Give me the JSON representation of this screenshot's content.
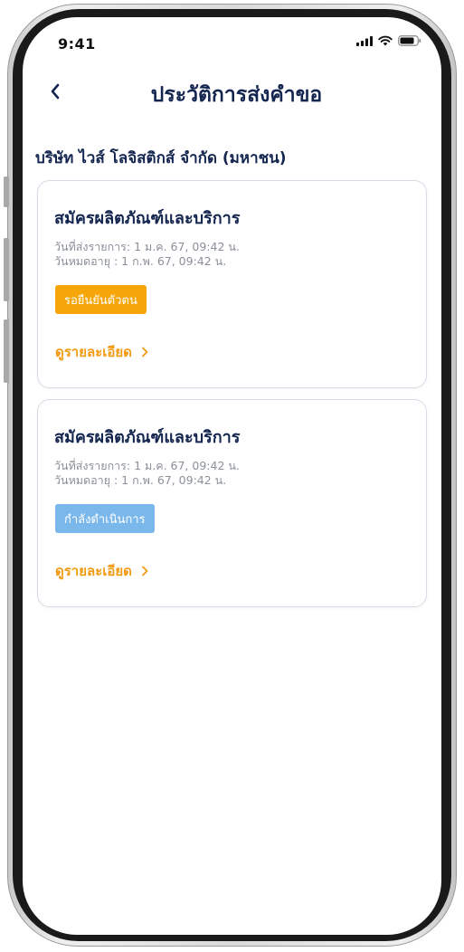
{
  "status_bar": {
    "time": "9:41",
    "icons": [
      "signal-icon",
      "wifi-icon",
      "battery-icon"
    ]
  },
  "nav": {
    "back_icon": "chevron-left-icon",
    "title": "ประวัติการส่งคำขอ"
  },
  "company": {
    "name": "บริษัท ไวส์ โลจิสติกส์ จำกัด (มหาชน)"
  },
  "requests": [
    {
      "title": "สมัครผลิตภัณฑ์และบริการ",
      "submitted": "วันที่ส่งรายการ: 1 ม.ค. 67, 09:42 น.",
      "expires": "วันหมดอายุ : 1 ก.พ. 67, 09:42 น.",
      "status": "รอยืนยันตัวตน",
      "status_color": "#f6a609",
      "link": "ดูรายละเอียด"
    },
    {
      "title": "สมัครผลิตภัณฑ์และบริการ",
      "submitted": "วันที่ส่งรายการ: 1 ม.ค. 67, 09:42 น.",
      "expires": "วันหมดอายุ : 1 ก.พ. 67, 09:42 น.",
      "status": "กำลังดำเนินการ",
      "status_color": "#7ab7ea",
      "link": "ดูรายละเอียด"
    }
  ],
  "colors": {
    "title_navy": "#14264f",
    "link_orange": "#f29a12",
    "meta_gray": "#8a8f9a",
    "card_border": "#d7dce6"
  }
}
